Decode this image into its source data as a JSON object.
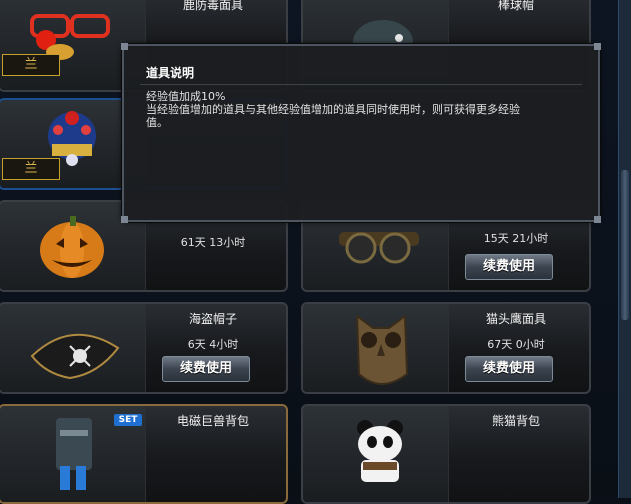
{
  "items": [
    {
      "name": "鹿防毒面具",
      "rank_badge": "兰"
    },
    {
      "name": "棒球帽"
    },
    {
      "rank_badge": "兰"
    },
    {
      "duration": "61天 13小时"
    },
    {
      "duration": "15天 21小时",
      "button": "续费使用"
    },
    {
      "name": "海盗帽子",
      "duration": "6天 4小时",
      "button": "续费使用"
    },
    {
      "name": "猫头鹰面具",
      "duration": "67天 0小时",
      "button": "续费使用"
    },
    {
      "name": "电磁巨兽背包",
      "badge": "SET"
    },
    {
      "name": "熊猫背包"
    }
  ],
  "tooltip": {
    "title": "道具说明",
    "line1": "经验值加成10%",
    "line2": "当经验值增加的道具与其他经验值增加的道具同时使用时，则可获得更多经验",
    "line3": "值。"
  },
  "colors": {
    "card_border": "#3b3f45",
    "selected_border": "#1c4f8f",
    "set_border": "#8a6a3a",
    "rank_gold": "#d9b64a",
    "set_badge": "#1e6fd0"
  }
}
